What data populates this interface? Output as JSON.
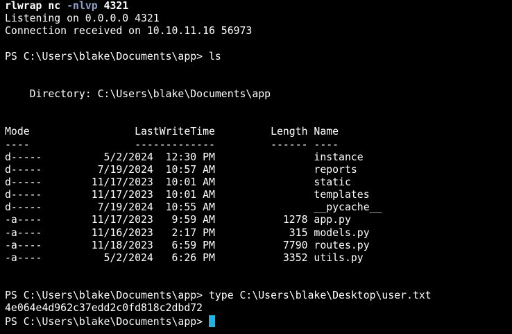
{
  "terminal": {
    "colors": {
      "background": "#000000",
      "text": "#ffffff",
      "flag": "#8fa3c8",
      "cursor": "#1fb3e6"
    },
    "command": {
      "program": "rlwrap",
      "sub": "nc",
      "flags": "-nlvp",
      "port": "4321"
    },
    "listening": "Listening on 0.0.0.0 4321",
    "connection": "Connection received on 10.10.11.16 56973",
    "prompt_ls": "PS C:\\Users\\blake\\Documents\\app> ls",
    "directory": "    Directory: C:\\Users\\blake\\Documents\\app",
    "header": "Mode                 LastWriteTime         Length Name",
    "separator": "----                 -------------         ------ ----",
    "rows": [
      "d-----          5/2/2024  12:30 PM                instance",
      "d-----         7/19/2024  10:57 AM                reports",
      "d-----        11/17/2023  10:01 AM                static",
      "d-----        11/17/2023  10:01 AM                templates",
      "d-----         7/19/2024  10:55 AM                __pycache__",
      "-a----        11/17/2023   9:59 AM           1278 app.py",
      "-a----        11/16/2023   2:17 PM            315 models.py",
      "-a----        11/18/2023   6:59 PM           7790 routes.py",
      "-a----          5/2/2024   6:26 PM           3352 utils.py"
    ],
    "prompt_type": "PS C:\\Users\\blake\\Documents\\app> type C:\\Users\\blake\\Desktop\\user.txt",
    "hash": "4e064e4d962c37edd2c0fd818c2dbd72",
    "prompt_final": "PS C:\\Users\\blake\\Documents\\app> "
  }
}
